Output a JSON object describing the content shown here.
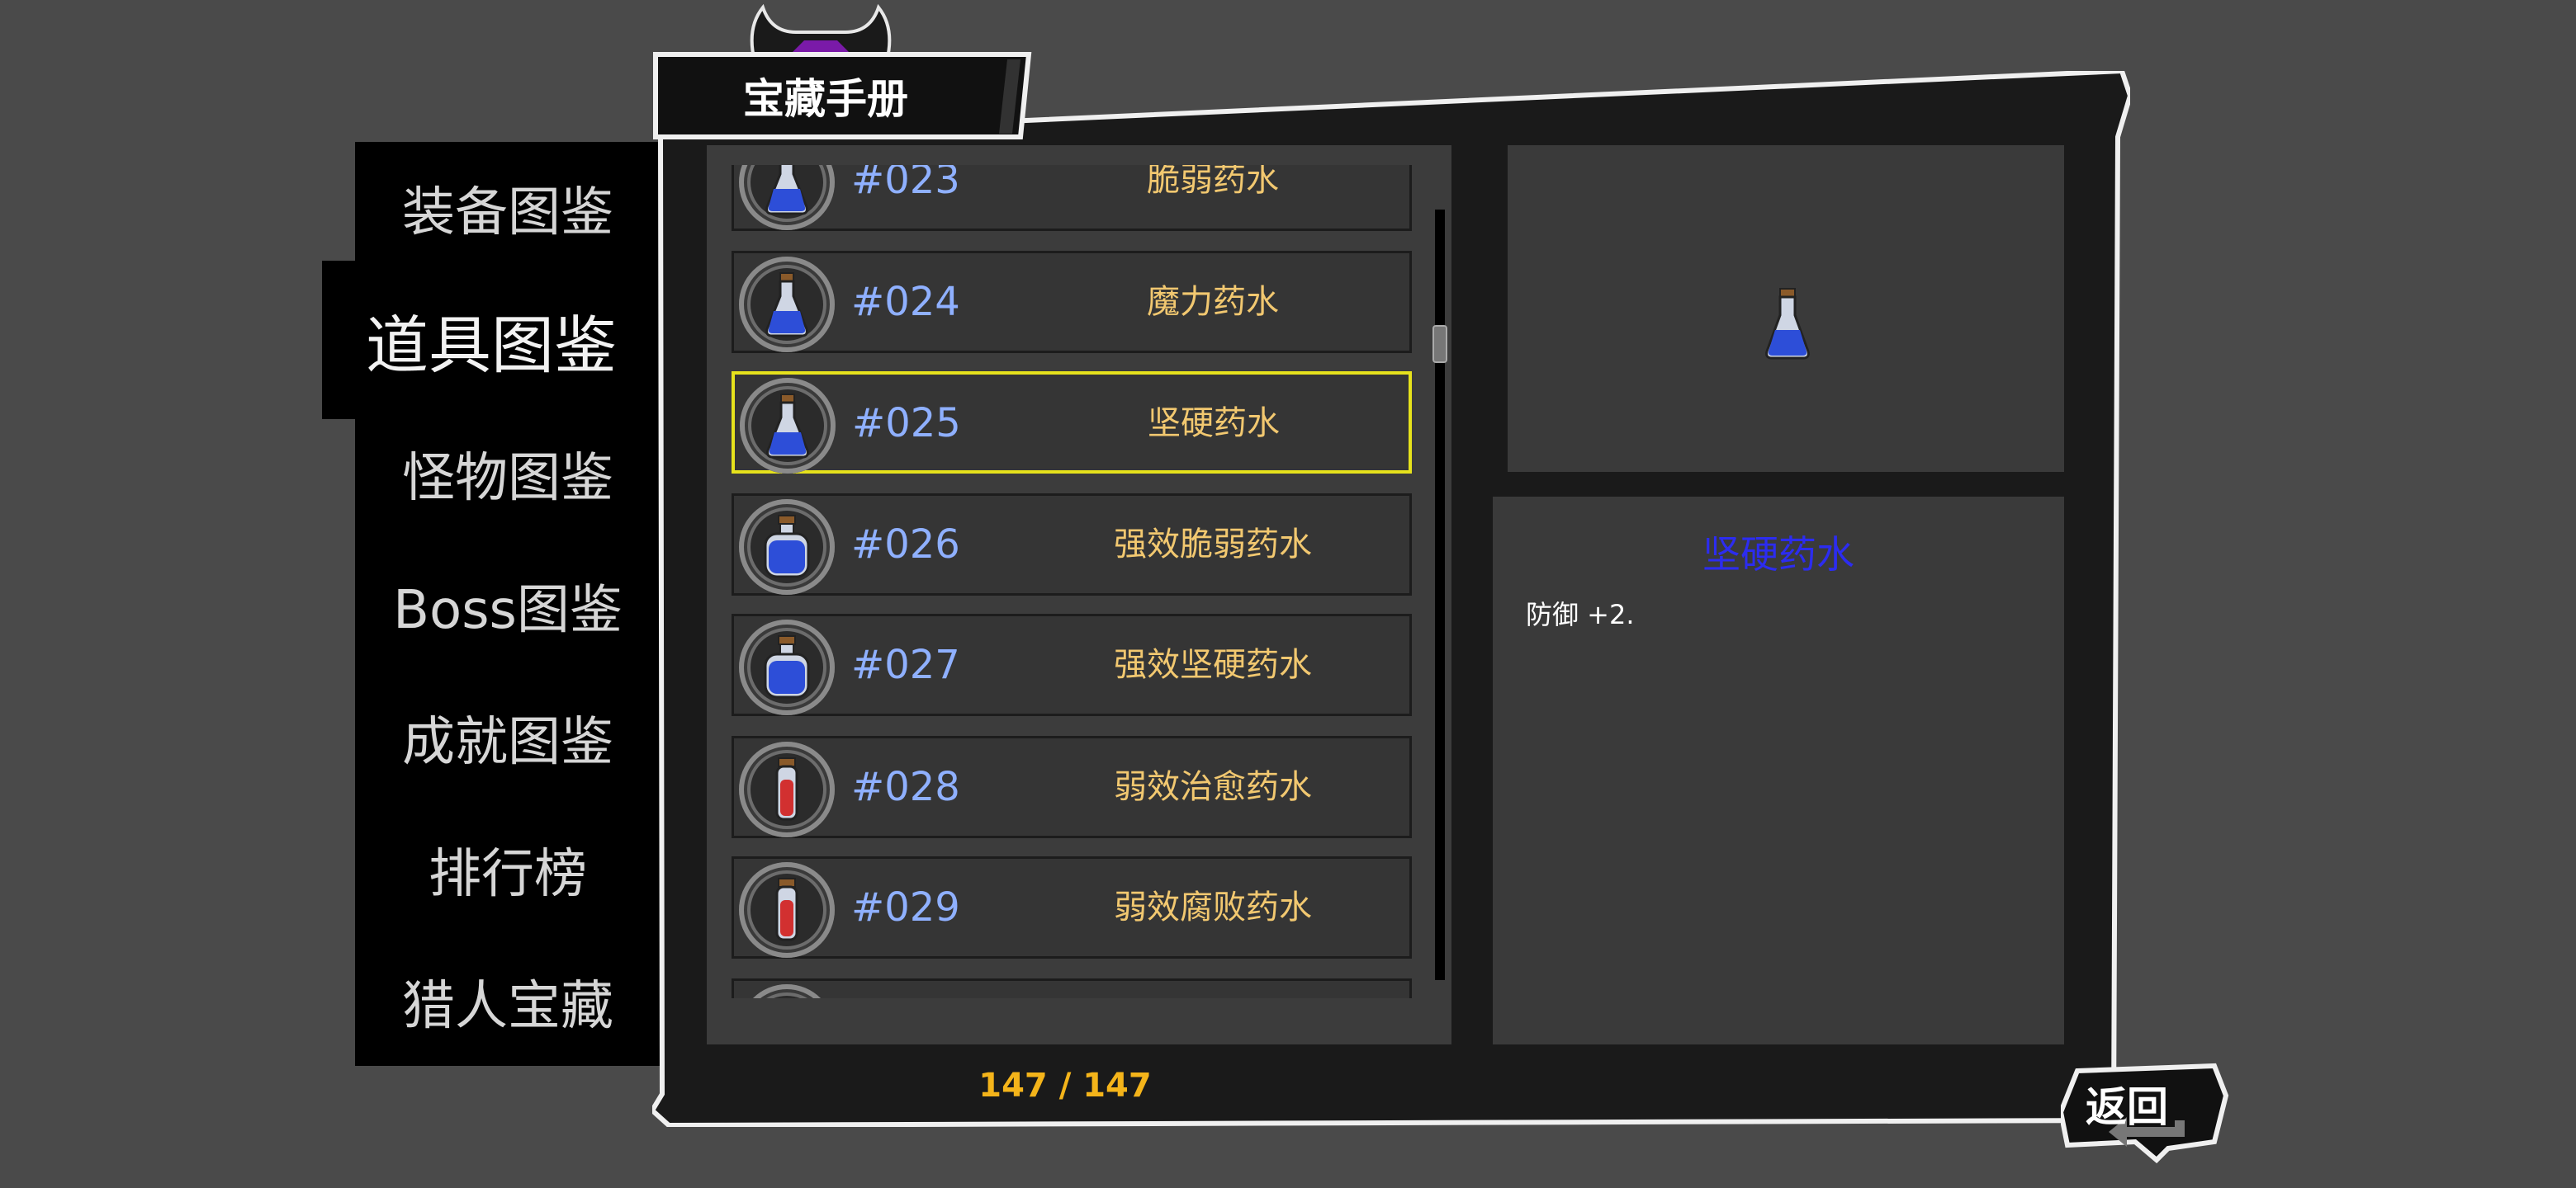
{
  "title": "宝藏手册",
  "sidebar": {
    "items": [
      {
        "label": "装备图鉴"
      },
      {
        "label": "道具图鉴"
      },
      {
        "label": "怪物图鉴"
      },
      {
        "label": "Boss图鉴"
      },
      {
        "label": "成就图鉴"
      },
      {
        "label": "排行榜"
      },
      {
        "label": "猎人宝藏"
      }
    ],
    "active_index": 1
  },
  "items": [
    {
      "number": "#023",
      "name": "脆弱药水",
      "icon": "blue-flask-icon",
      "color": "#2d4ed8"
    },
    {
      "number": "#024",
      "name": "魔力药水",
      "icon": "blue-flask-icon",
      "color": "#2d4ed8"
    },
    {
      "number": "#025",
      "name": "坚硬药水",
      "icon": "blue-flask-icon",
      "color": "#2d4ed8",
      "selected": true
    },
    {
      "number": "#026",
      "name": "强效脆弱药水",
      "icon": "blue-bottle-icon",
      "color": "#2d4ed8"
    },
    {
      "number": "#027",
      "name": "强效坚硬药水",
      "icon": "blue-bottle-icon",
      "color": "#2d4ed8"
    },
    {
      "number": "#028",
      "name": "弱效治愈药水",
      "icon": "red-vial-icon",
      "color": "#d23030"
    },
    {
      "number": "#029",
      "name": "弱效腐败药水",
      "icon": "red-vial-icon",
      "color": "#d23030"
    }
  ],
  "counter": "147 / 147",
  "detail": {
    "name": "坚硬药水",
    "description": "防御 +2.",
    "icon": "blue-flask-icon"
  },
  "back_label": "返回",
  "colors": {
    "background": "#4a4a4a",
    "selected_border": "#e6e21c",
    "item_number": "#8fb0ff",
    "item_name": "#f2c870",
    "counter": "#f4b41a",
    "detail_name": "#2c2cf0"
  }
}
